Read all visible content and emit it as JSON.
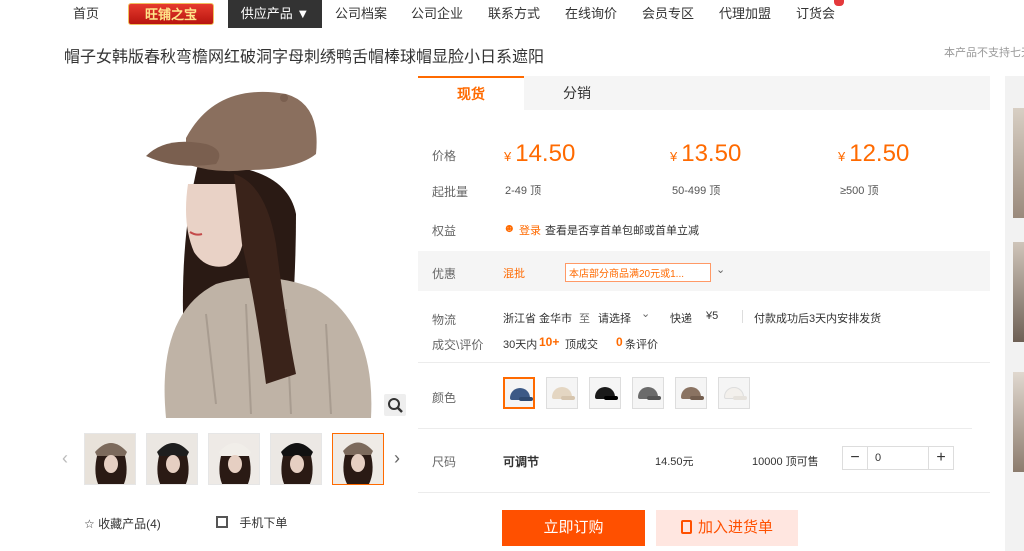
{
  "nav": {
    "home": "首页",
    "logo": "旺铺之宝",
    "active": "供应产品 ▼",
    "items": [
      "公司档案",
      "公司企业",
      "联系方式",
      "在线询价",
      "会员专区",
      "代理加盟",
      "订货会"
    ]
  },
  "product": {
    "title": "帽子女韩版春秋弯檐网红破洞字母刺绣鸭舌帽棒球帽显脸小日系遮阳",
    "notice": "本产品不支持七天"
  },
  "gallery": {
    "favorite": "收藏产品(4)",
    "mobile": "手机下单"
  },
  "tabs": {
    "spot": "现货",
    "distribute": "分销"
  },
  "pricing": {
    "price_label": "价格",
    "moq_label": "起批量",
    "currency": "¥",
    "tiers": [
      {
        "price": "14.50",
        "qty": "2-49 顶"
      },
      {
        "price": "13.50",
        "qty": "50-499 顶"
      },
      {
        "price": "12.50",
        "qty": "≥500 顶"
      }
    ]
  },
  "benefits": {
    "label": "权益",
    "login": "登录",
    "text": "查看是否享首单包邮或首单立减"
  },
  "promo": {
    "label": "优惠",
    "mixed": "混批",
    "tag": "本店部分商品满20元或1..."
  },
  "logistics": {
    "label": "物流",
    "from": "浙江省 金华市",
    "to_word": "至",
    "select": "请选择",
    "method": "快递",
    "fee": "¥5",
    "ship_note": "付款成功后3天内安排发货"
  },
  "deals": {
    "label": "成交\\评价",
    "period": "30天内",
    "count": "10+",
    "count_unit": "顶成交",
    "reviews": "0",
    "reviews_unit": "条评价"
  },
  "color": {
    "label": "颜色"
  },
  "size": {
    "label": "尺码",
    "value": "可调节",
    "price": "14.50元",
    "stock": "10000 顶可售",
    "qty": "0",
    "minus": "−",
    "plus": "+"
  },
  "actions": {
    "buy": "立即订购",
    "cart": "加入进货单"
  },
  "colors": {
    "accent": "#ff6a00",
    "buy_bg": "#ff5000",
    "cart_bg": "#ffe6e0"
  }
}
